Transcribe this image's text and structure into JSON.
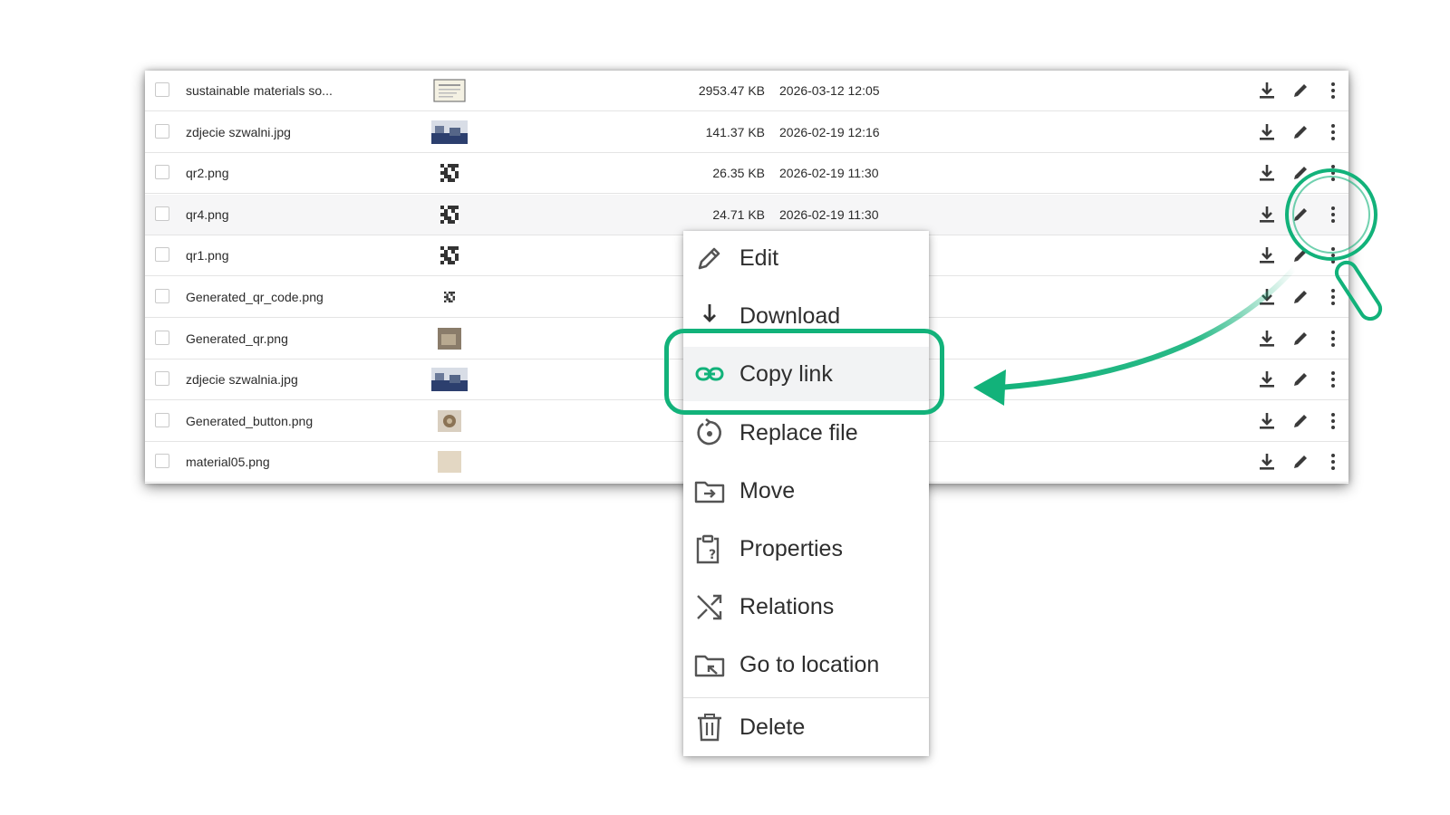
{
  "files": [
    {
      "name": "sustainable materials so...",
      "size": "2953.47 KB",
      "date": "2026-03-12 12:05",
      "thumb": "certificate"
    },
    {
      "name": "zdjecie szwalni.jpg",
      "size": "141.37 KB",
      "date": "2026-02-19 12:16",
      "thumb": "photo-blue"
    },
    {
      "name": "qr2.png",
      "size": "26.35 KB",
      "date": "2026-02-19 11:30",
      "thumb": "qr"
    },
    {
      "name": "qr4.png",
      "size": "24.71 KB",
      "date": "2026-02-19 11:30",
      "thumb": "qr"
    },
    {
      "name": "qr1.png",
      "size": "",
      "date": "",
      "thumb": "qr"
    },
    {
      "name": "Generated_qr_code.png",
      "size": "",
      "date": "",
      "thumb": "qr-small"
    },
    {
      "name": "Generated_qr.png",
      "size": "",
      "date": "",
      "thumb": "photo-brown"
    },
    {
      "name": "zdjecie szwalnia.jpg",
      "size": "",
      "date": "",
      "thumb": "photo-blue"
    },
    {
      "name": "Generated_button.png",
      "size": "",
      "date": "",
      "thumb": "photo-button"
    },
    {
      "name": "material05.png",
      "size": "",
      "date": "",
      "thumb": "fabric"
    }
  ],
  "row_icons": {
    "download": "download-icon",
    "edit": "pencil-icon",
    "more": "more-vertical-icon"
  },
  "context_menu": {
    "items": [
      {
        "label": "Edit",
        "icon": "pencil-icon"
      },
      {
        "label": "Download",
        "icon": "download-arrow-icon"
      },
      {
        "label": "Copy link",
        "icon": "link-icon"
      },
      {
        "label": "Replace file",
        "icon": "replace-icon"
      },
      {
        "label": "Move",
        "icon": "folder-move-icon"
      },
      {
        "label": "Properties",
        "icon": "clipboard-question-icon"
      },
      {
        "label": "Relations",
        "icon": "shuffle-icon"
      },
      {
        "label": "Go to location",
        "icon": "folder-goto-icon"
      },
      {
        "label": "Delete",
        "icon": "trash-icon"
      }
    ],
    "highlighted": "Copy link"
  },
  "colors": {
    "accent": "#12b27a",
    "row_highlight": "#f6f6f7",
    "text": "#2b2b2b"
  }
}
